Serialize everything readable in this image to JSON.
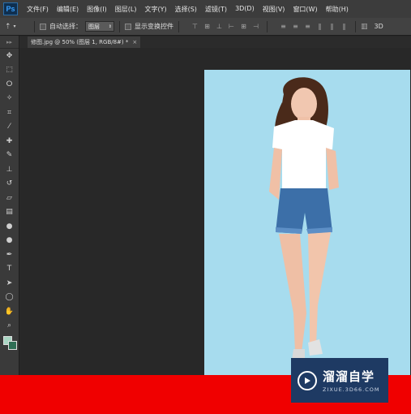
{
  "app": {
    "logo_text": "Ps"
  },
  "menu": [
    "文件(F)",
    "编辑(E)",
    "图像(I)",
    "图层(L)",
    "文字(Y)",
    "选择(S)",
    "滤镜(T)",
    "3D(D)",
    "视图(V)",
    "窗口(W)",
    "帮助(H)"
  ],
  "options": {
    "auto_select_label": "自动选择：",
    "auto_select_value": "图层",
    "show_transform_label": "显示变换控件",
    "workspace_label": "3D"
  },
  "document": {
    "tab_title": "修图.jpg @ 50% (图层 1, RGB/8#) *",
    "close_glyph": "×"
  },
  "colors": {
    "foreground": "#a9d6c3",
    "background": "#2f6e55",
    "canvas_bg": "#a7dcee",
    "banner": "#f00000"
  },
  "tools": [
    "move-icon",
    "marquee-icon",
    "lasso-icon",
    "magic-wand-icon",
    "crop-icon",
    "eyedropper-icon",
    "healing-brush-icon",
    "brush-icon",
    "clone-stamp-icon",
    "history-brush-icon",
    "eraser-icon",
    "gradient-icon",
    "blur-icon",
    "dodge-icon",
    "pen-icon",
    "type-icon",
    "path-select-icon",
    "shape-icon",
    "hand-icon",
    "zoom-icon"
  ],
  "watermark": {
    "title": "溜溜自学",
    "site": "ZIXUE.3D66.COM"
  }
}
